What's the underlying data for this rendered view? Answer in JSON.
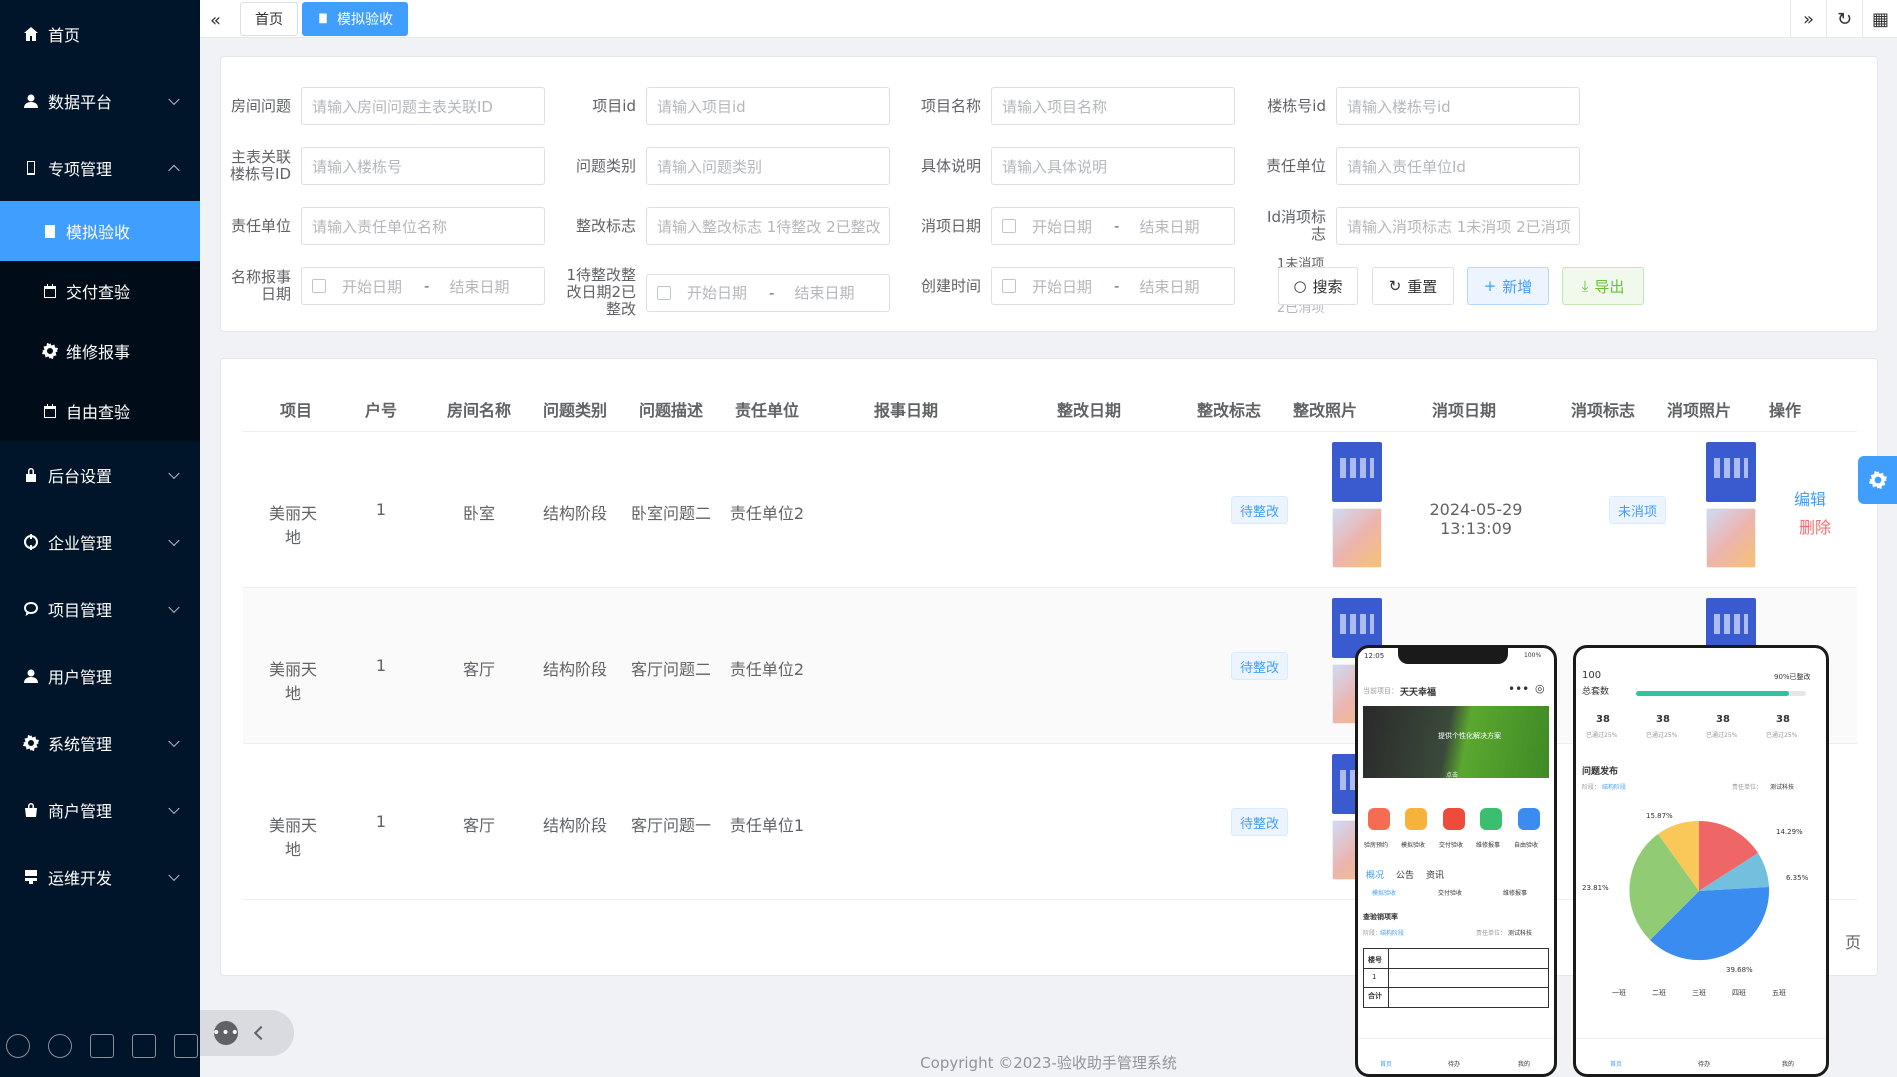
{
  "sidebar": {
    "home": "首页",
    "data_platform": "数据平台",
    "special": "专项管理",
    "sub": [
      "模拟验收",
      "交付查验",
      "维修报事",
      "自由查验"
    ],
    "backend": "后台设置",
    "enterprise": "企业管理",
    "project": "项目管理",
    "user": "用户管理",
    "system": "系统管理",
    "merchant": "商户管理",
    "devops": "运维开发"
  },
  "tabs": {
    "home": "首页",
    "active": "模拟验收"
  },
  "search": {
    "l_room_issue": "房间问题",
    "p_room_issue": "请输入房间问题主表关联ID",
    "l_project_id": "项目id",
    "p_project_id": "请输入项目id",
    "l_project_name": "项目名称",
    "p_project_name": "请输入项目名称",
    "l_building_id": "楼栋号id",
    "p_building_id": "请输入楼栋号id",
    "l_building_no": "主表关联楼栋号ID",
    "p_building_no": "请输入楼栋号",
    "l_issue_type": "问题类别",
    "p_issue_type": "请输入问题类别",
    "l_detail": "具体说明",
    "p_detail": "请输入具体说明",
    "l_resp_unit": "责任单位",
    "p_resp_unit": "请输入责任单位Id",
    "l_resp_unit2": "责任单位",
    "p_resp_unit2": "请输入责任单位名称",
    "l_rect_flag": "整改标志",
    "p_rect_flag": "请输入整改标志 1待整改 2已整改",
    "l_close_date": "消项日期",
    "l_close_flag": "Id消项标志",
    "p_close_flag": "请输入消项标志 1未消项 2已消项",
    "l_report_date": "名称报事日期",
    "l_rect_date": "1待整改整改日期2已整改",
    "l_create_time": "创建时间",
    "overflow": "1未消项",
    "overflow2": "2已消项",
    "start": "开始日期",
    "end": "结束日期",
    "dash": "-",
    "btn_search": "搜索",
    "btn_reset": "重置",
    "btn_add": "新增",
    "btn_export": "导出"
  },
  "table": {
    "headers": [
      "项目",
      "户号",
      "房间名称",
      "问题类别",
      "问题描述",
      "责任单位",
      "报事日期",
      "整改日期",
      "整改标志",
      "整改照片",
      "消项日期",
      "消项标志",
      "消项照片",
      "操作"
    ],
    "rows": [
      {
        "project": "美丽天地",
        "unit": "1",
        "room": "卧室",
        "type": "结构阶段",
        "desc": "卧室问题二",
        "resp": "责任单位2",
        "flag": "待整改",
        "close_date": "2024-05-29 13:13:09",
        "close_flag": "未消项"
      },
      {
        "project": "美丽天地",
        "unit": "1",
        "room": "客厅",
        "type": "结构阶段",
        "desc": "客厅问题二",
        "resp": "责任单位2",
        "flag": "待整改"
      },
      {
        "project": "美丽天地",
        "unit": "1",
        "room": "客厅",
        "type": "结构阶段",
        "desc": "客厅问题一",
        "resp": "责任单位1",
        "flag": "待整改"
      }
    ],
    "edit": "编辑",
    "delete": "删除",
    "page_suffix": "页"
  },
  "footer": "Copyright ©2023-验收助手管理系统",
  "phone1": {
    "time": "12:05",
    "battery": "100%",
    "project_label": "当前项目：",
    "project": "天天幸福",
    "banner_text": "提供个性化解决方案",
    "banner_btn": "点击",
    "icons": [
      "验房预约",
      "模拟验收",
      "交付验收",
      "维修报事",
      "自由验收"
    ],
    "tabs": [
      "概况",
      "公告",
      "资讯"
    ],
    "subtabs": [
      "模拟验收",
      "交付验收",
      "维修报事"
    ],
    "section": "查验销项率",
    "stage_label": "阶段：",
    "stage": "结构阶段",
    "unit_label": "责任单位：",
    "unit": "测试科技",
    "col_building": "楼号",
    "row1": "1",
    "total": "合计",
    "nav": [
      "首页",
      "待办",
      "我的"
    ]
  },
  "phone2": {
    "total_num": "100",
    "total_label": "总套数",
    "pct": "90%已整改",
    "stats": [
      "38",
      "38",
      "38",
      "38"
    ],
    "stat_label": "已通过25%",
    "section": "问题发布",
    "stage_label": "阶段：",
    "stage": "结构阶段",
    "unit_label": "责任单位：",
    "unit": "测试科技",
    "slices": [
      "15.87%",
      "14.29%",
      "6.35%",
      "23.81%",
      "39.68%"
    ],
    "legend": [
      "一班",
      "二班",
      "三班",
      "四班",
      "五班"
    ],
    "nav": [
      "首页",
      "待办",
      "我的"
    ]
  },
  "colors": {
    "primary": "#409eff",
    "sidebar": "#001529",
    "success": "#67c23a",
    "danger": "#f56c6c"
  }
}
